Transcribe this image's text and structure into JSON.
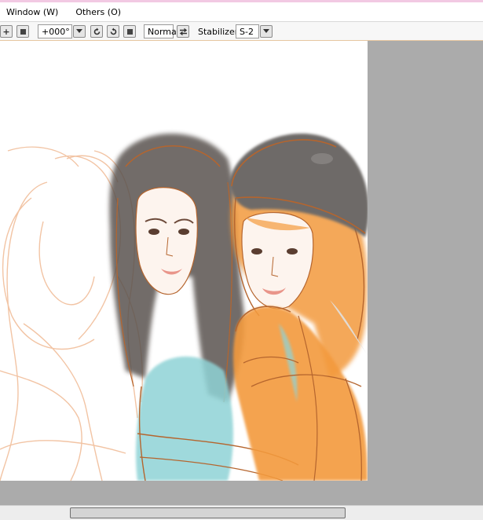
{
  "menu": {
    "items": [
      {
        "label": "Window (W)"
      },
      {
        "label": "Others (O)"
      }
    ]
  },
  "toolbar": {
    "zoom_in_icon": "plus-icon",
    "zoom_out_icon": "square-icon",
    "angle_value": "+000°",
    "rotate_left_icon": "rotate-ccw-icon",
    "rotate_right_icon": "rotate-cw-icon",
    "reset_icon": "square-icon",
    "view_mode": "Normal",
    "flip_icon": "flip-arrows-icon",
    "stabilizer_label": "Stabilizer",
    "stabilizer_value": "S-2"
  },
  "colors": {
    "workspace_bg": "#ababab",
    "canvas_bg": "#ffffff",
    "sketch_line": "#b5652e",
    "light_sketch": "#f2c4a4",
    "orange_fill": "#f39a3c",
    "teal_fill": "#8fd3d6",
    "hair_dark": "#5a5350",
    "hat_grey": "#6e6a68"
  }
}
